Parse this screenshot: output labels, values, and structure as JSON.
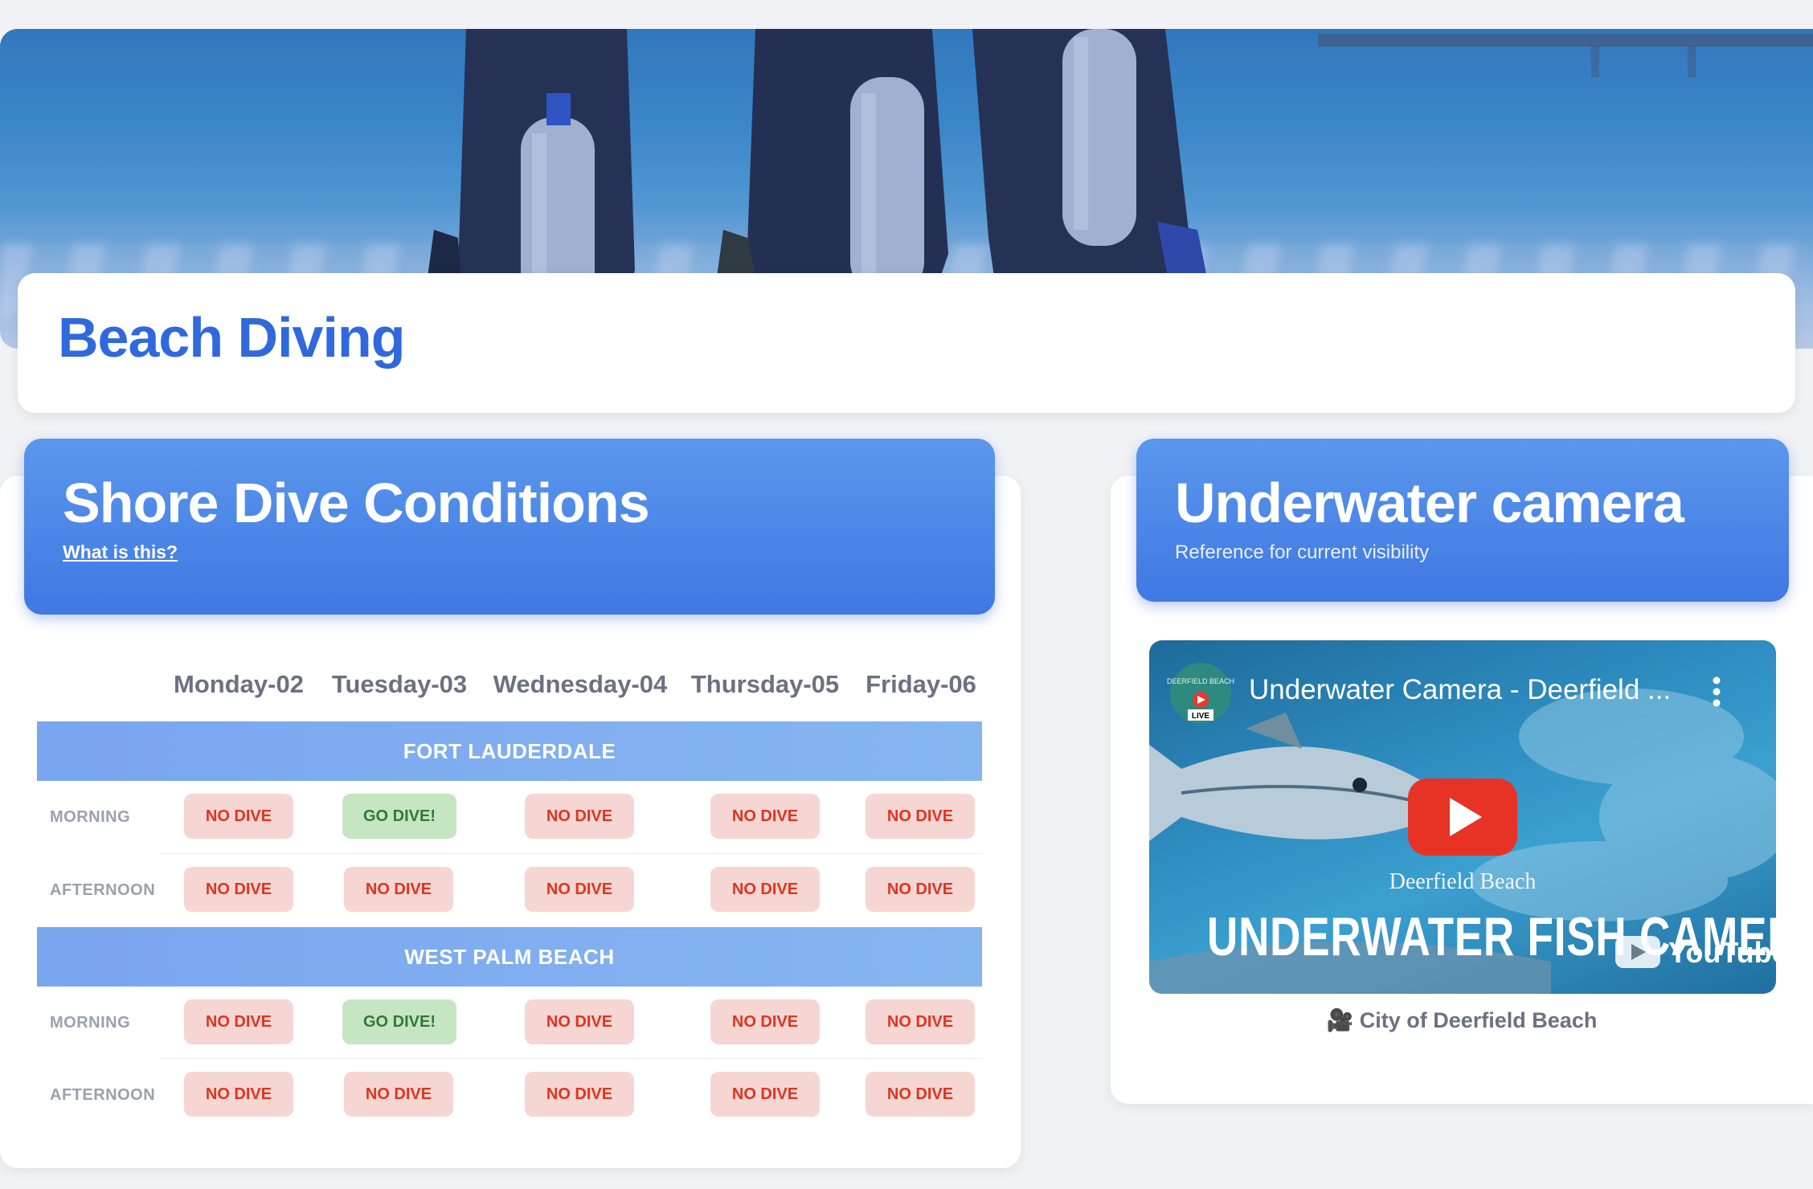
{
  "page": {
    "title": "Beach Diving"
  },
  "conditions": {
    "title": "Shore Dive Conditions",
    "help_link": "What is this?",
    "days": [
      "Monday-02",
      "Tuesday-03",
      "Wednesday-04",
      "Thursday-05",
      "Friday-06"
    ],
    "regions": [
      {
        "name": "FORT LAUDERDALE",
        "rows": [
          {
            "label": "MORNING",
            "cells": [
              "NO DIVE",
              "GO DIVE!",
              "NO DIVE",
              "NO DIVE",
              "NO DIVE"
            ]
          },
          {
            "label": "AFTERNOON",
            "cells": [
              "NO DIVE",
              "NO DIVE",
              "NO DIVE",
              "NO DIVE",
              "NO DIVE"
            ]
          }
        ]
      },
      {
        "name": "WEST PALM BEACH",
        "rows": [
          {
            "label": "MORNING",
            "cells": [
              "NO DIVE",
              "GO DIVE!",
              "NO DIVE",
              "NO DIVE",
              "NO DIVE"
            ]
          },
          {
            "label": "AFTERNOON",
            "cells": [
              "NO DIVE",
              "NO DIVE",
              "NO DIVE",
              "NO DIVE",
              "NO DIVE"
            ]
          }
        ]
      }
    ]
  },
  "camera": {
    "title": "Underwater camera",
    "subtitle": "Reference for current visibility",
    "video_title": "Underwater Camera - Deerfield ...",
    "channel_badge_top": "DEERFIELD BEACH",
    "channel_badge_live": "LIVE",
    "thumb_brand": "Deerfield Beach",
    "thumb_headline": "UNDERWATER FISH CAMERA",
    "thumb_platform": "YouTube",
    "caption": "🎥 City of Deerfield Beach"
  },
  "colors": {
    "accent": "#3069dc",
    "no_dive_bg": "#f6d6d3",
    "no_dive_text": "#e0341e",
    "go_dive_bg": "#c6e6c3",
    "go_dive_text": "#2f7a36"
  }
}
